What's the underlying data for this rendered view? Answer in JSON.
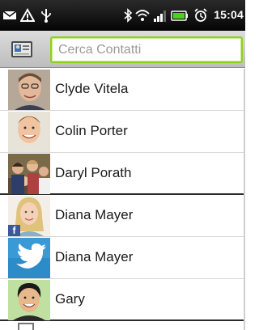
{
  "status_bar": {
    "time": "15:04",
    "icons": [
      "message-icon",
      "warning-icon",
      "usb-icon",
      "bluetooth-icon",
      "wifi-icon",
      "signal-icon",
      "battery-icon",
      "alarm-icon"
    ]
  },
  "search": {
    "placeholder": "Cerca Contatti"
  },
  "contacts": [
    {
      "name": "Clyde Vitela",
      "avatar": "photo"
    },
    {
      "name": "Colin Porter",
      "avatar": "photo"
    },
    {
      "name": "Daryl Porath",
      "avatar": "photo"
    },
    {
      "name": "Diana Mayer",
      "avatar": "photo-facebook"
    },
    {
      "name": "Diana Mayer",
      "avatar": "twitter"
    },
    {
      "name": "Gary",
      "avatar": "photo"
    }
  ],
  "colors": {
    "search_focus": "#8dd11d",
    "facebook": "#3b5998",
    "twitter": "#2b8cc9",
    "status_bar": "#0a0a0a"
  }
}
